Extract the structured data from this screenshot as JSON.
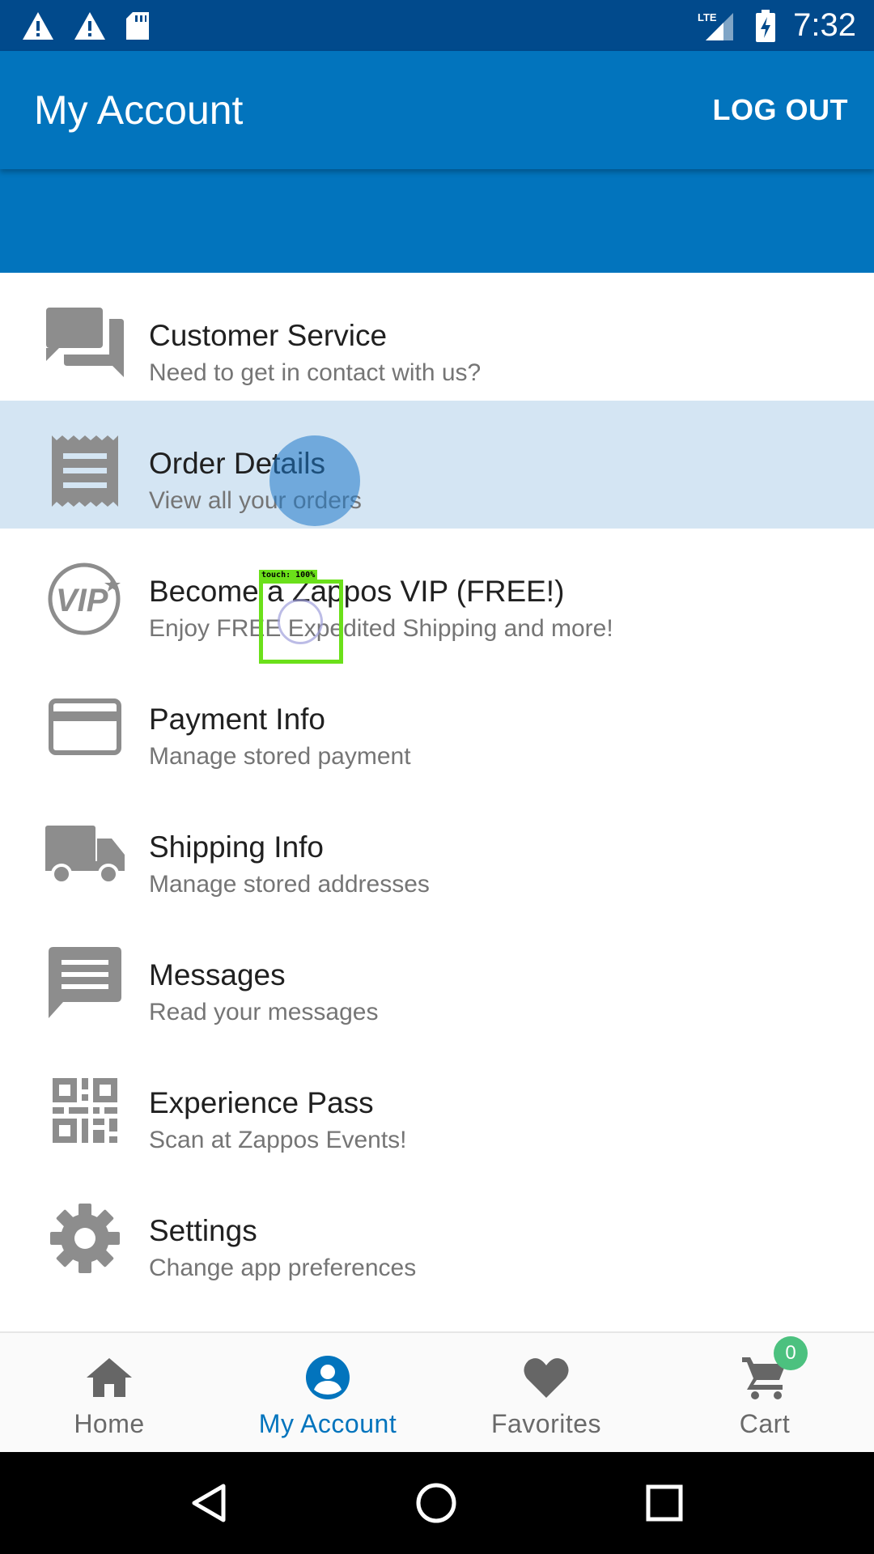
{
  "status_bar": {
    "time": "7:32",
    "network": "LTE",
    "left_icons": [
      "warning-icon",
      "warning-icon",
      "sd-card-icon"
    ],
    "right_icons": [
      "lte-signal-icon",
      "battery-charging-icon"
    ]
  },
  "app_bar": {
    "title": "My Account",
    "logout_label": "LOG OUT",
    "color": "#0274bd"
  },
  "menu": {
    "items": [
      {
        "title": "Customer Service",
        "subtitle": "Need to get in contact with us?",
        "icon": "forum-icon"
      },
      {
        "title": "Order Details",
        "subtitle": "View all your orders",
        "icon": "receipt-icon",
        "pressed": true
      },
      {
        "title": "Become a Zappos VIP (FREE!)",
        "subtitle": "Enjoy FREE Expedited Shipping and more!",
        "icon": "vip-icon"
      },
      {
        "title": "Payment Info",
        "subtitle": "Manage stored payment",
        "icon": "credit-card-icon"
      },
      {
        "title": "Shipping Info",
        "subtitle": "Manage stored addresses",
        "icon": "truck-icon"
      },
      {
        "title": "Messages",
        "subtitle": "Read your messages",
        "icon": "message-icon"
      },
      {
        "title": "Experience Pass",
        "subtitle": "Scan at Zappos Events!",
        "icon": "qr-code-icon"
      },
      {
        "title": "Settings",
        "subtitle": "Change app preferences",
        "icon": "gear-icon"
      }
    ]
  },
  "touch_overlay": {
    "label": "touch: 100%"
  },
  "vip_icon_text": "VIP",
  "bottom_nav": {
    "items": [
      {
        "label": "Home",
        "icon": "home-icon"
      },
      {
        "label": "My Account",
        "icon": "account-circle-icon",
        "active": true
      },
      {
        "label": "Favorites",
        "icon": "heart-icon"
      },
      {
        "label": "Cart",
        "icon": "cart-icon",
        "badge": "0"
      }
    ],
    "active_color": "#0274bd",
    "badge_color": "#4cc17f"
  },
  "system_nav": [
    "back-icon",
    "home-circle-icon",
    "recents-icon"
  ]
}
